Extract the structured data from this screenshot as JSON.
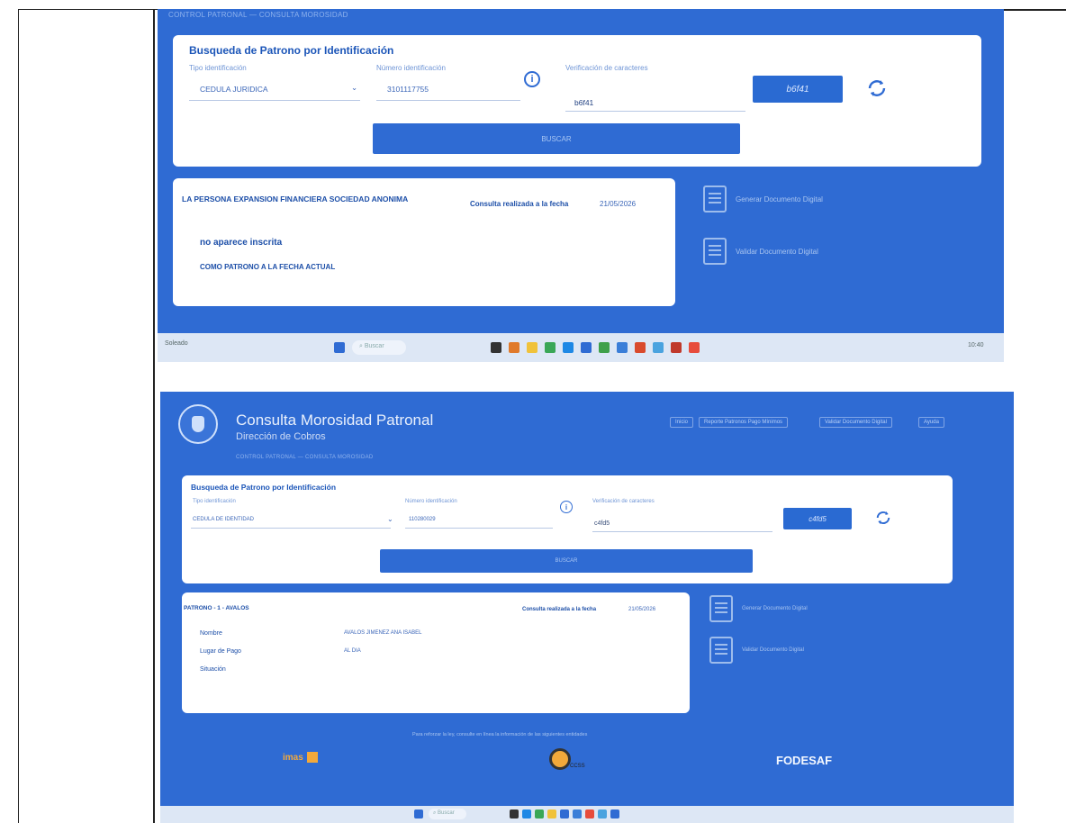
{
  "shot1": {
    "breadcrumb": "CONTROL PATRONAL — CONSULTA MOROSIDAD",
    "search_card": {
      "title": "Busqueda de Patrono por Identificación",
      "tipo_label": "Tipo identificación",
      "tipo_value": "CEDULA JURIDICA",
      "numero_label": "Número identificación",
      "numero_value": "3101117755",
      "verif_label": "Verificación de caracteres",
      "verif_value": "b6f41",
      "captcha_text": "b6f41",
      "buscar_label": "BUSCAR"
    },
    "result_card": {
      "persona": "LA PERSONA EXPANSION FINANCIERA SOCIEDAD ANONIMA",
      "consulta_label": "Consulta realizada a la fecha",
      "consulta_date": "21/05/2026",
      "line1": "no aparece inscrita",
      "line2": "COMO PATRONO A LA FECHA ACTUAL"
    },
    "side_links": [
      "Generar Documento Digital",
      "Validar Documento Digital"
    ],
    "taskbar": {
      "search_placeholder": "Buscar",
      "weather": "Soleado",
      "clock": "10:40"
    }
  },
  "shot2": {
    "header_title": "Consulta Morosidad Patronal",
    "header_subtitle": "Dirección de Cobros",
    "breadcrumb": "CONTROL PATRONAL — CONSULTA MOROSIDAD",
    "nav": [
      "Inicio",
      "Reporte Patronos Pago Mínimos",
      "Validar Documento Digital",
      "Ayuda"
    ],
    "search_card": {
      "title": "Busqueda de Patrono por Identificación",
      "tipo_label": "Tipo identificación",
      "tipo_value": "CEDULA DE IDENTIDAD",
      "numero_label": "Número identificación",
      "numero_value": "110280029",
      "verif_label": "Verificación de caracteres",
      "verif_value": "c4fd5",
      "captcha_text": "c4fd5",
      "buscar_label": "BUSCAR"
    },
    "result_card": {
      "patrono_header": "PATRONO - 1 - AVALOS",
      "consulta_label": "Consulta realizada a la fecha",
      "consulta_date": "21/05/2026",
      "rows": [
        {
          "label": "Nombre",
          "value": "AVALOS JIMENEZ ANA ISABEL"
        },
        {
          "label": "Lugar de Pago",
          "value": "AL DIA"
        },
        {
          "label": "Situación",
          "value": ""
        }
      ]
    },
    "side_links": [
      "Generar Documento Digital",
      "Validar Documento Digital"
    ],
    "footer_text": "Para reforzar la ley, consulte en línea la información de las siguientes entidades",
    "footer_logos": [
      "imas",
      "CCSS",
      "FODESAF"
    ],
    "taskbar": {
      "search_placeholder": "Buscar"
    }
  },
  "colors": {
    "brand_blue": "#2f6bd3",
    "card": "#ffffff",
    "title_blue": "#1b55b8"
  }
}
